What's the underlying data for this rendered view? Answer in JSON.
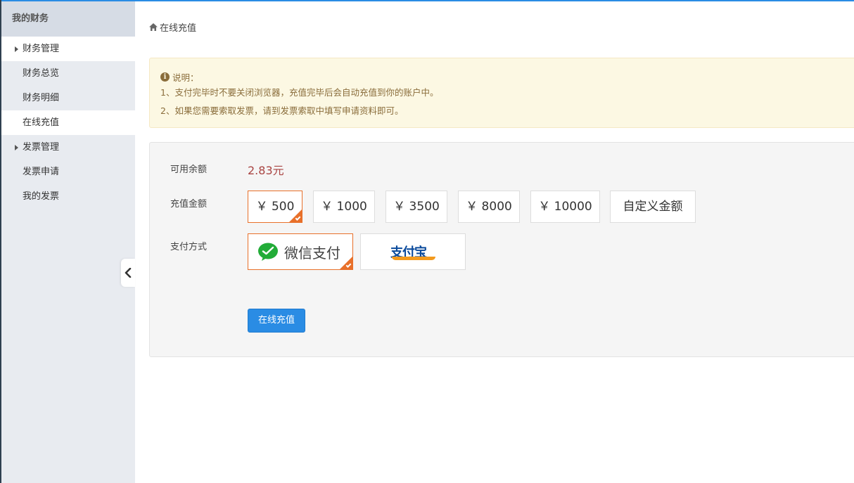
{
  "sidebar": {
    "title": "我的财务",
    "items": [
      {
        "label": "财务管理",
        "type": "group"
      },
      {
        "label": "财务总览",
        "type": "sub"
      },
      {
        "label": "财务明细",
        "type": "sub"
      },
      {
        "label": "在线充值",
        "type": "sub",
        "active": true
      },
      {
        "label": "发票管理",
        "type": "group"
      },
      {
        "label": "发票申请",
        "type": "sub"
      },
      {
        "label": "我的发票",
        "type": "sub"
      }
    ]
  },
  "breadcrumb": {
    "icon": "home-icon",
    "label": "在线充值"
  },
  "notice": {
    "title": "说明：",
    "lines": [
      "1、支付完毕时不要关闭浏览器，充值完毕后会自动充值到你的账户中。",
      "2、如果您需要索取发票，请到发票索取中填写申请资料即可。"
    ]
  },
  "form": {
    "balance_label": "可用余额",
    "balance_value": "2.83元",
    "amount_label": "充值金额",
    "amounts": [
      "￥ 500",
      "￥ 1000",
      "￥ 3500",
      "￥ 8000",
      "￥ 10000",
      "自定义金额"
    ],
    "selected_amount": "￥ 500",
    "payment_label": "支付方式",
    "payments": [
      {
        "label": "微信支付",
        "icon": "wechat-icon",
        "selected": true
      },
      {
        "label": "支付宝",
        "icon": "alipay-logo",
        "selected": false
      }
    ],
    "submit_label": "在线充值"
  },
  "colors": {
    "accent": "#2a8ce4",
    "selected_border": "#e8702a",
    "balance": "#a94442",
    "notice_bg": "#fcf8e3",
    "notice_text": "#8a6d3b"
  }
}
